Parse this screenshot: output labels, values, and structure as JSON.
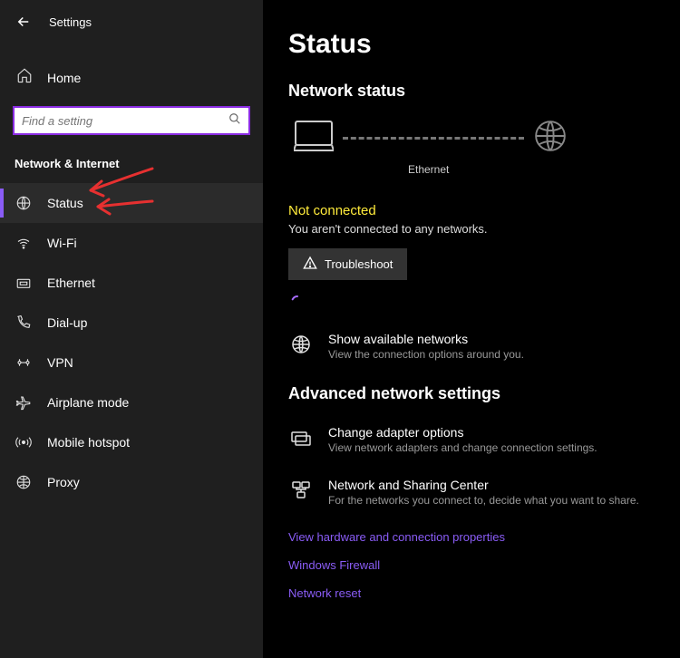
{
  "header": {
    "app_title": "Settings"
  },
  "sidebar": {
    "home_label": "Home",
    "search_placeholder": "Find a setting",
    "section_title": "Network & Internet",
    "items": [
      {
        "label": "Status"
      },
      {
        "label": "Wi-Fi"
      },
      {
        "label": "Ethernet"
      },
      {
        "label": "Dial-up"
      },
      {
        "label": "VPN"
      },
      {
        "label": "Airplane mode"
      },
      {
        "label": "Mobile hotspot"
      },
      {
        "label": "Proxy"
      }
    ]
  },
  "main": {
    "page_title": "Status",
    "subheading": "Network status",
    "diagram_label": "Ethernet",
    "status_warning": "Not connected",
    "status_sub": "You aren't connected to any networks.",
    "troubleshoot_label": "Troubleshoot",
    "actions": {
      "available": {
        "title": "Show available networks",
        "desc": "View the connection options around you."
      }
    },
    "advanced_heading": "Advanced network settings",
    "advanced": {
      "adapter": {
        "title": "Change adapter options",
        "desc": "View network adapters and change connection settings."
      },
      "sharing": {
        "title": "Network and Sharing Center",
        "desc": "For the networks you connect to, decide what you want to share."
      }
    },
    "links": {
      "hardware": "View hardware and connection properties",
      "firewall": "Windows Firewall",
      "reset": "Network reset"
    }
  }
}
